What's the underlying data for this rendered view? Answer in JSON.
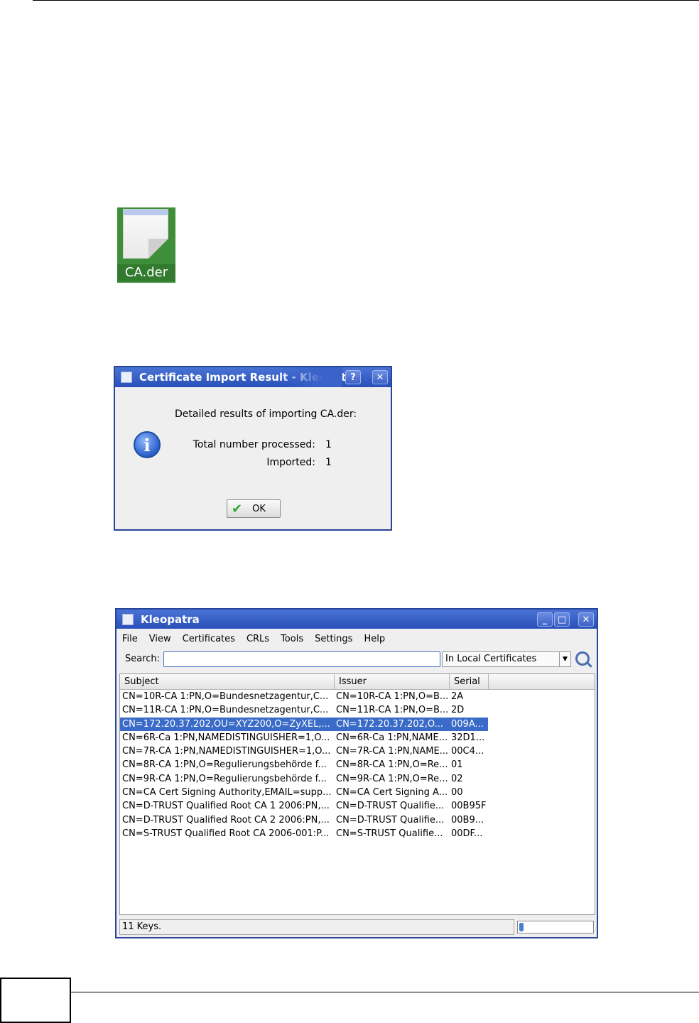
{
  "desktop_file": {
    "label": "CA.der"
  },
  "dialog": {
    "title": "Certificate Import Result - Kleopatra",
    "help_glyph": "?",
    "close_glyph": "✕",
    "heading": "Detailed results of importing CA.der:",
    "stats": [
      {
        "label": "Total number processed:",
        "value": "1"
      },
      {
        "label": "Imported:",
        "value": "1"
      }
    ],
    "ok_label": "OK",
    "icon": "info-icon"
  },
  "kleopatra": {
    "title": "Kleopatra",
    "window_buttons": {
      "minimize": "_",
      "maximize": "□",
      "close": "✕"
    },
    "menu": [
      "File",
      "View",
      "Certificates",
      "CRLs",
      "Tools",
      "Settings",
      "Help"
    ],
    "search_label": "Search:",
    "search_value": "",
    "scope_selected": "In Local Certificates",
    "columns": [
      "Subject",
      "Issuer",
      "Serial"
    ],
    "rows": [
      [
        "CN=10R-CA 1:PN,O=Bundesnetzagentur,C...",
        "CN=10R-CA 1:PN,O=B...",
        "2A"
      ],
      [
        "CN=11R-CA 1:PN,O=Bundesnetzagentur,C...",
        "CN=11R-CA 1:PN,O=B...",
        "2D"
      ],
      [
        "CN=172.20.37.202,OU=XYZ200,O=ZyXEL,...",
        "CN=172.20.37.202,O...",
        "009A..."
      ],
      [
        "CN=6R-Ca 1:PN,NAMEDISTINGUISHER=1,O...",
        "CN=6R-Ca 1:PN,NAME...",
        "32D1..."
      ],
      [
        "CN=7R-CA 1:PN,NAMEDISTINGUISHER=1,O...",
        "CN=7R-CA 1:PN,NAME...",
        "00C4..."
      ],
      [
        "CN=8R-CA 1:PN,O=Regulierungsbehörde f...",
        "CN=8R-CA 1:PN,O=Re...",
        "01"
      ],
      [
        "CN=9R-CA 1:PN,O=Regulierungsbehörde f...",
        "CN=9R-CA 1:PN,O=Re...",
        "02"
      ],
      [
        "CN=CA Cert Signing Authority,EMAIL=supp...",
        "CN=CA Cert Signing A...",
        "00"
      ],
      [
        "CN=D-TRUST Qualified Root CA 1 2006:PN,...",
        "CN=D-TRUST Qualifie...",
        "00B95F"
      ],
      [
        "CN=D-TRUST Qualified Root CA 2 2006:PN,...",
        "CN=D-TRUST Qualifie...",
        "00B9..."
      ],
      [
        "CN=S-TRUST Qualified Root CA 2006-001:P...",
        "CN=S-TRUST Qualifie...",
        "00DF..."
      ]
    ],
    "selected_row": 2,
    "status": "11 Keys.",
    "progress": 0.05
  }
}
